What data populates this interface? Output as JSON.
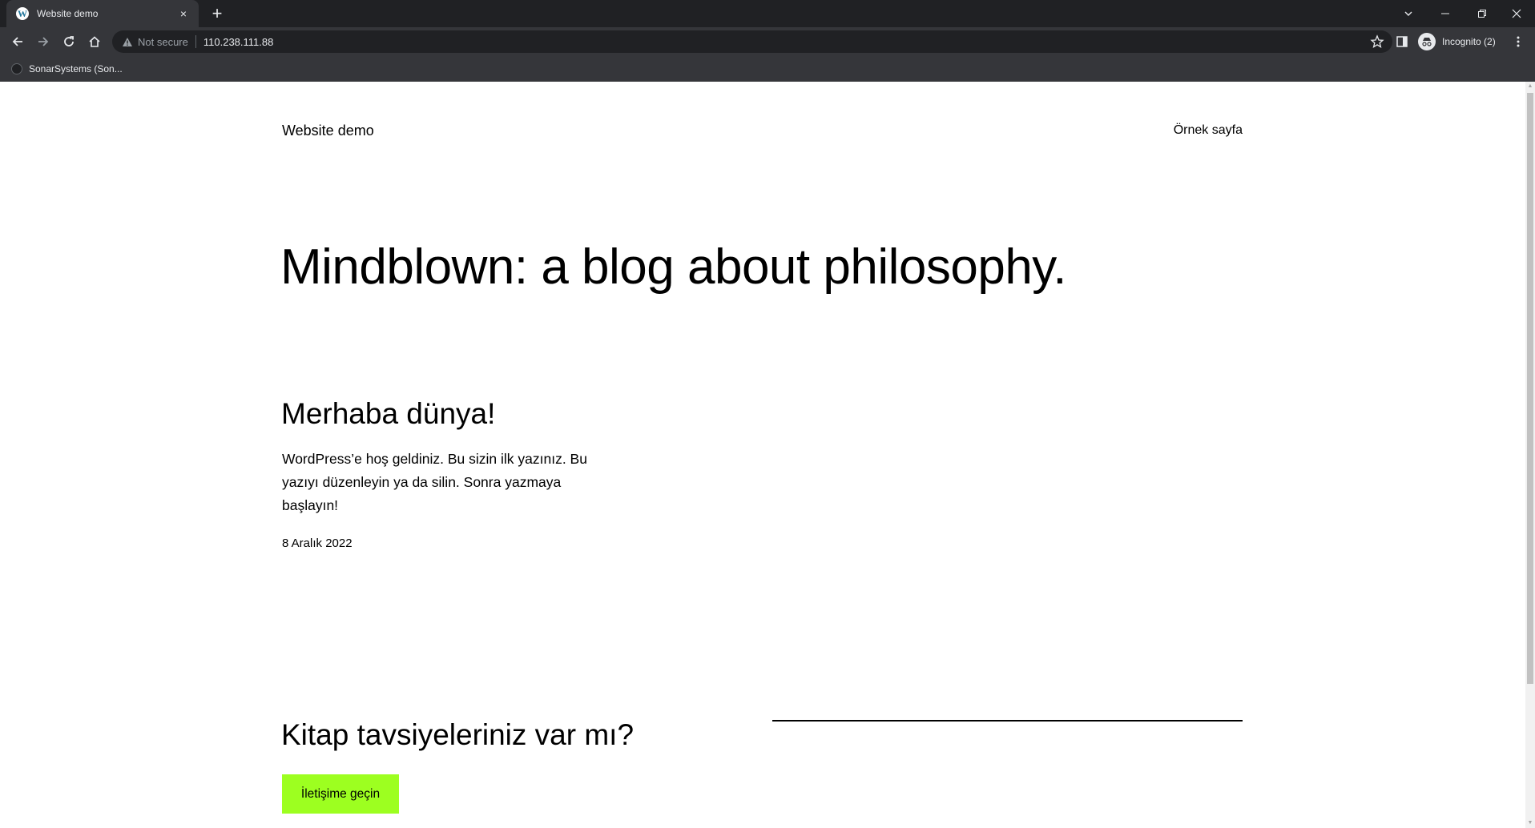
{
  "browser": {
    "tab_title": "Website demo",
    "tab_favicon": "W",
    "new_tab": "+",
    "security_label": "Not secure",
    "url": "110.238.111.88",
    "profile_label": "Incognito (2)",
    "bookmarks": [
      {
        "label": "SonarSystems (Son..."
      }
    ],
    "icons": {
      "close": "×",
      "menu": "⋮",
      "tab_search": "⌵",
      "minimize": "–",
      "restore": "❐",
      "window_close": "✕"
    }
  },
  "site": {
    "title": "Website demo",
    "nav": [
      {
        "label": "Örnek sayfa"
      }
    ]
  },
  "hero": {
    "heading": "Mindblown: a blog about philosophy."
  },
  "post": {
    "title": "Merhaba dünya!",
    "excerpt": "WordPress’e hoş geldiniz. Bu sizin ilk yazınız. Bu yazıyı düzenleyin ya da silin. Sonra yazmaya başlayın!",
    "date": "8 Aralık 2022"
  },
  "cta": {
    "heading": "Kitap tavsiyeleriniz var mı?",
    "button_label": "İletişime geçin"
  },
  "colors": {
    "cta_button": "#9dff20",
    "chrome_dark": "#202124",
    "chrome_toolbar": "#35363a"
  }
}
